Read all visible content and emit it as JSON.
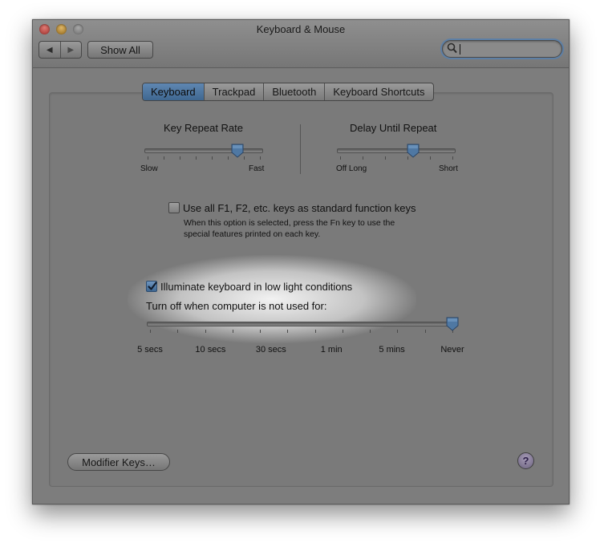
{
  "window": {
    "title": "Keyboard & Mouse"
  },
  "toolbar": {
    "back_label": "◀",
    "forward_label": "▶",
    "show_all_label": "Show All",
    "search_value": "",
    "search_placeholder": ""
  },
  "tabs": [
    {
      "label": "Keyboard",
      "active": true
    },
    {
      "label": "Trackpad",
      "active": false
    },
    {
      "label": "Bluetooth",
      "active": false
    },
    {
      "label": "Keyboard Shortcuts",
      "active": false
    }
  ],
  "key_repeat": {
    "title": "Key Repeat Rate",
    "min_label": "Slow",
    "max_label": "Fast",
    "ticks": 8,
    "value_fraction": 0.8
  },
  "delay_repeat": {
    "title": "Delay Until Repeat",
    "min_label": "Off Long",
    "max_label": "Short",
    "ticks": 6,
    "value_fraction": 0.65
  },
  "fn_keys": {
    "checked": false,
    "label": "Use all F1, F2, etc. keys as standard function keys",
    "help_line1": "When this option is selected, press the Fn key to use the",
    "help_line2": "special features printed on each key."
  },
  "illumination": {
    "checked": true,
    "label": "Illuminate keyboard in low light conditions",
    "turn_off_label": "Turn off when computer is not used for:",
    "value_fraction": 1.0,
    "ticks": 12,
    "labels": [
      "5 secs",
      "10 secs",
      "30 secs",
      "1 min",
      "5 mins",
      "Never"
    ]
  },
  "footer": {
    "modifier_keys_label": "Modifier Keys…",
    "help_label": "?"
  },
  "colors": {
    "window_bg": "#7d7d7d",
    "accent": "#4f78a3",
    "search_ring": "#5d7fa5"
  }
}
